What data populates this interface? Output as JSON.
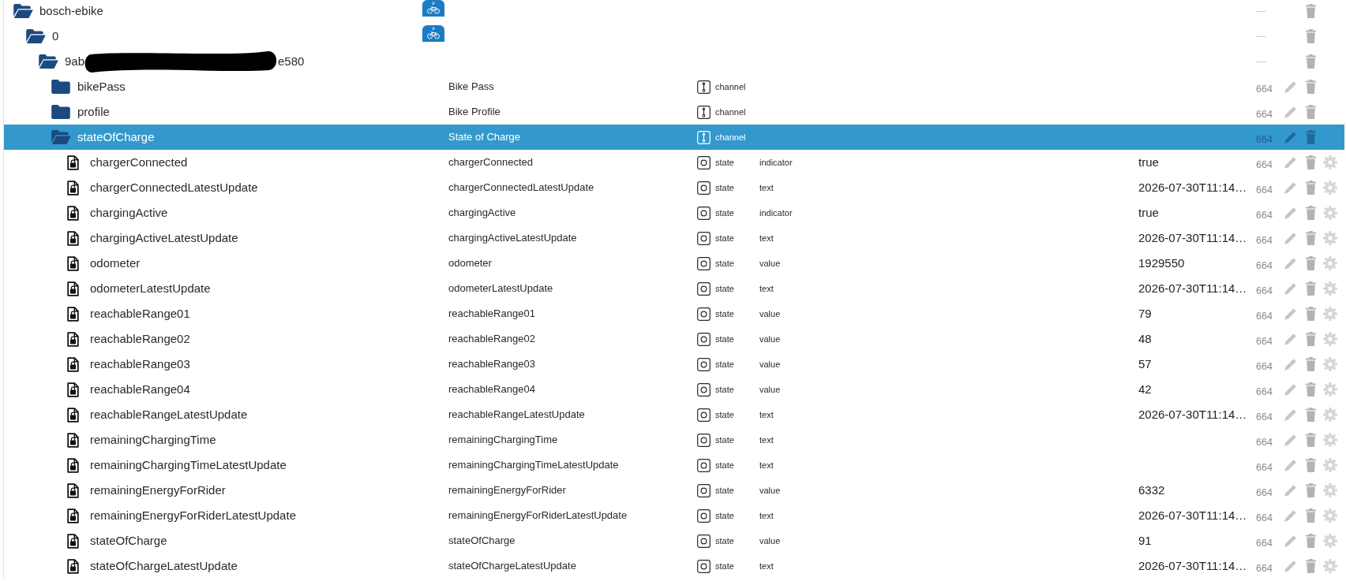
{
  "tree": [
    {
      "kind": "adapter",
      "name": "bosch-ebike",
      "expanded": true,
      "selected": false,
      "acl": "—",
      "children": [
        {
          "kind": "instance",
          "name": "0",
          "expanded": true,
          "selected": false,
          "acl": "—",
          "children": [
            {
              "kind": "device",
              "name": "9ab",
              "name_tail": "e580",
              "redacted": true,
              "expanded": true,
              "selected": false,
              "acl": "—",
              "children": [
                {
                  "kind": "channel",
                  "name": "bikePass",
                  "title": "Bike Pass",
                  "type": "channel",
                  "expanded": false,
                  "selected": false,
                  "acl": "664"
                },
                {
                  "kind": "channel",
                  "name": "profile",
                  "title": "Bike Profile",
                  "type": "channel",
                  "expanded": false,
                  "selected": false,
                  "acl": "664"
                },
                {
                  "kind": "channel",
                  "name": "stateOfCharge",
                  "title": "State of Charge",
                  "type": "channel",
                  "expanded": true,
                  "selected": true,
                  "acl": "664",
                  "children": [
                    {
                      "kind": "state",
                      "name": "chargerConnected",
                      "title": "chargerConnected",
                      "type": "state",
                      "role": "indicator",
                      "value": "true",
                      "selected": false,
                      "acl": "664"
                    },
                    {
                      "kind": "state",
                      "name": "chargerConnectedLatestUpdate",
                      "title": "chargerConnectedLatestUpdate",
                      "type": "state",
                      "role": "text",
                      "value": "2026-07-30T11:14…",
                      "selected": false,
                      "acl": "664"
                    },
                    {
                      "kind": "state",
                      "name": "chargingActive",
                      "title": "chargingActive",
                      "type": "state",
                      "role": "indicator",
                      "value": "true",
                      "selected": false,
                      "acl": "664"
                    },
                    {
                      "kind": "state",
                      "name": "chargingActiveLatestUpdate",
                      "title": "chargingActiveLatestUpdate",
                      "type": "state",
                      "role": "text",
                      "value": "2026-07-30T11:14…",
                      "selected": false,
                      "acl": "664"
                    },
                    {
                      "kind": "state",
                      "name": "odometer",
                      "title": "odometer",
                      "type": "state",
                      "role": "value",
                      "value": "1929550",
                      "selected": false,
                      "acl": "664"
                    },
                    {
                      "kind": "state",
                      "name": "odometerLatestUpdate",
                      "title": "odometerLatestUpdate",
                      "type": "state",
                      "role": "text",
                      "value": "2026-07-30T11:14…",
                      "selected": false,
                      "acl": "664"
                    },
                    {
                      "kind": "state",
                      "name": "reachableRange01",
                      "title": "reachableRange01",
                      "type": "state",
                      "role": "value",
                      "value": "79",
                      "selected": false,
                      "acl": "664"
                    },
                    {
                      "kind": "state",
                      "name": "reachableRange02",
                      "title": "reachableRange02",
                      "type": "state",
                      "role": "value",
                      "value": "48",
                      "selected": false,
                      "acl": "664"
                    },
                    {
                      "kind": "state",
                      "name": "reachableRange03",
                      "title": "reachableRange03",
                      "type": "state",
                      "role": "value",
                      "value": "57",
                      "selected": false,
                      "acl": "664"
                    },
                    {
                      "kind": "state",
                      "name": "reachableRange04",
                      "title": "reachableRange04",
                      "type": "state",
                      "role": "value",
                      "value": "42",
                      "selected": false,
                      "acl": "664"
                    },
                    {
                      "kind": "state",
                      "name": "reachableRangeLatestUpdate",
                      "title": "reachableRangeLatestUpdate",
                      "type": "state",
                      "role": "text",
                      "value": "2026-07-30T11:14…",
                      "selected": false,
                      "acl": "664"
                    },
                    {
                      "kind": "state",
                      "name": "remainingChargingTime",
                      "title": "remainingChargingTime",
                      "type": "state",
                      "role": "text",
                      "selected": false,
                      "acl": "664"
                    },
                    {
                      "kind": "state",
                      "name": "remainingChargingTimeLatestUpdate",
                      "title": "remainingChargingTimeLatestUpdate",
                      "type": "state",
                      "role": "text",
                      "selected": false,
                      "acl": "664"
                    },
                    {
                      "kind": "state",
                      "name": "remainingEnergyForRider",
                      "title": "remainingEnergyForRider",
                      "type": "state",
                      "role": "value",
                      "value": "6332",
                      "selected": false,
                      "acl": "664"
                    },
                    {
                      "kind": "state",
                      "name": "remainingEnergyForRiderLatestUpdate",
                      "title": "remainingEnergyForRiderLatestUpdate",
                      "type": "state",
                      "role": "text",
                      "value": "2026-07-30T11:14…",
                      "selected": false,
                      "acl": "664"
                    },
                    {
                      "kind": "state",
                      "name": "stateOfCharge",
                      "title": "stateOfCharge",
                      "type": "state",
                      "role": "value",
                      "value": "91",
                      "selected": false,
                      "acl": "664"
                    },
                    {
                      "kind": "state",
                      "name": "stateOfChargeLatestUpdate",
                      "title": "stateOfChargeLatestUpdate",
                      "type": "state",
                      "role": "text",
                      "value": "2026-07-30T11:14…",
                      "selected": false,
                      "acl": "664"
                    }
                  ]
                }
              ]
            }
          ]
        }
      ]
    }
  ]
}
